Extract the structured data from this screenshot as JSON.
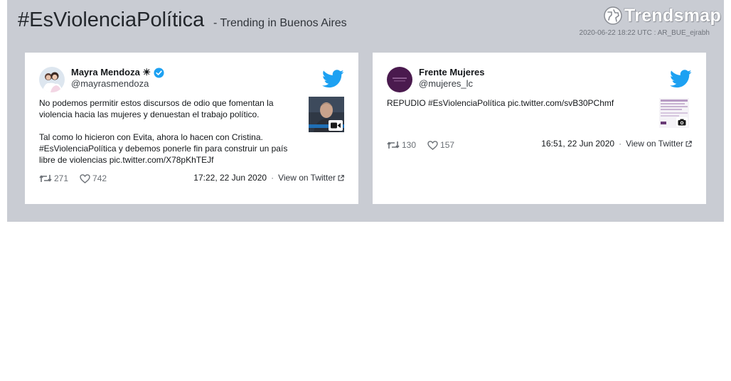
{
  "header": {
    "hashtag": "#EsViolenciaPolítica",
    "subtitle": "- Trending in Buenos Aires",
    "brand": "Trendsmap",
    "meta": "2020-06-22 18:22 UTC : AR_BUE_ejrabh"
  },
  "tweets": [
    {
      "name": "Mayra Mendoza ☀",
      "verified": true,
      "handle": "@mayrasmendoza",
      "text_paragraph_1": "No podemos permitir estos discursos de odio que fomentan la violencia hacia las mujeres y denuestan el trabajo político.",
      "text_paragraph_2": "Tal como lo hicieron con Evita, ahora lo hacen con Cristina. #EsViolenciaPolítica y debemos ponerle fin para construir un país libre de violencias pic.twitter.com/X78pKhTEJf",
      "media_type": "video",
      "retweets": "271",
      "likes": "742",
      "timestamp": "17:22, 22 Jun 2020",
      "separator": "·",
      "view_link": "View on Twitter"
    },
    {
      "name": "Frente Mujeres",
      "verified": false,
      "handle": "@mujeres_lc",
      "text_paragraph_1": "REPUDIO #EsViolenciaPolítica pic.twitter.com/svB30PChmf",
      "media_type": "photo",
      "retweets": "130",
      "likes": "157",
      "timestamp": "16:51, 22 Jun 2020",
      "separator": "·",
      "view_link": "View on Twitter"
    }
  ],
  "colors": {
    "panel_bg": "#c9ccd3",
    "twitter_blue": "#1da1f2",
    "card_bg": "#ffffff",
    "avatar2_bg": "#4a1a4e"
  },
  "icons": [
    "trendsmap-logo-icon",
    "twitter-bird-icon",
    "verified-badge-icon",
    "retweet-icon",
    "heart-icon",
    "external-link-icon",
    "video-camera-icon",
    "camera-icon"
  ]
}
